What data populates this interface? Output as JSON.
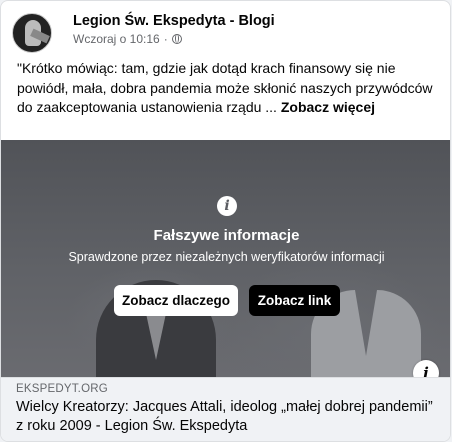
{
  "post": {
    "page_name": "Legion Św. Ekspedyta - Blogi",
    "timestamp": "Wczoraj o 10:16",
    "separator": "·",
    "privacy_icon": "globe-icon",
    "text": "\"Krótko mówiąc: tam, gdzie jak dotąd krach finansowy się nie powiódł, mała, dobra pandemia może skłonić naszych przywódców do zaakceptowania ustanowienia rządu ... ",
    "see_more": "Zobacz więcej"
  },
  "warning": {
    "icon": "info-icon",
    "title": "Fałszywe informacje",
    "subtitle": "Sprawdzone przez niezależnych weryfikatorów informacji",
    "why_button": "Zobacz dlaczego",
    "link_button": "Zobacz link"
  },
  "link_preview": {
    "domain": "EKSPEDYT.ORG",
    "title": "Wielcy Kreatorzy: Jacques Attali, ideolog „małej dobrej pandemii” z roku 2009 - Legion Św. Ekspedyta"
  }
}
